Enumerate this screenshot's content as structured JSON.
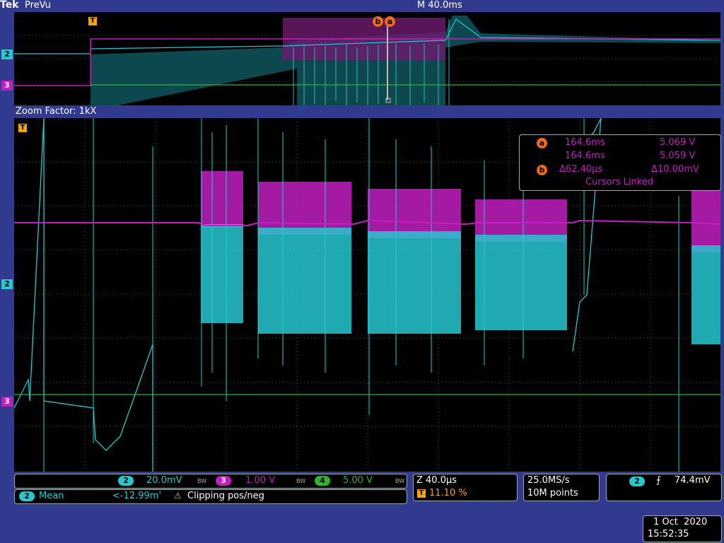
{
  "header": {
    "brand": "Tek",
    "mode": "PreVu",
    "timebase": "M 40.0ms"
  },
  "zoom": {
    "label": "Zoom Factor: 1kX"
  },
  "channel_markers": {
    "ch2": "2",
    "ch3": "3",
    "trigger": "T"
  },
  "cursors": {
    "a_label": "a",
    "b_label": "b",
    "a_time": "164.6ms",
    "a_volt": "5.069 V",
    "b_time": "164.6ms",
    "b_volt": "5.059 V",
    "delta_time": "Δ62.40µs",
    "delta_volt": "Δ10.00mV",
    "linked": "Cursors Linked"
  },
  "channels": {
    "ch2": {
      "num": "2",
      "scale": "20.0mV"
    },
    "ch3": {
      "num": "3",
      "scale": "1.00 V"
    },
    "ch4": {
      "num": "4",
      "scale": "5.00 V"
    },
    "bw": "BW"
  },
  "measurement": {
    "num": "2",
    "name": "Mean",
    "value": "<-12.99m'",
    "warning": "Clipping pos/neg"
  },
  "zoom_info": {
    "time": "Z 40.0µs",
    "trigger_icon": "T",
    "position": "11.10 %"
  },
  "acquisition": {
    "rate": "25.0MS/s",
    "points": "10M points"
  },
  "trigger": {
    "num": "2",
    "slope": "⨍",
    "level": "74.4mV"
  },
  "datetime": {
    "date": "1 Oct  2020",
    "time": "15:52:35"
  },
  "colors": {
    "cyan": "#27c7d0",
    "magenta": "#c21ec0",
    "green": "#2fb32f",
    "orange": "#f4a20e",
    "background": "#313a8e"
  }
}
